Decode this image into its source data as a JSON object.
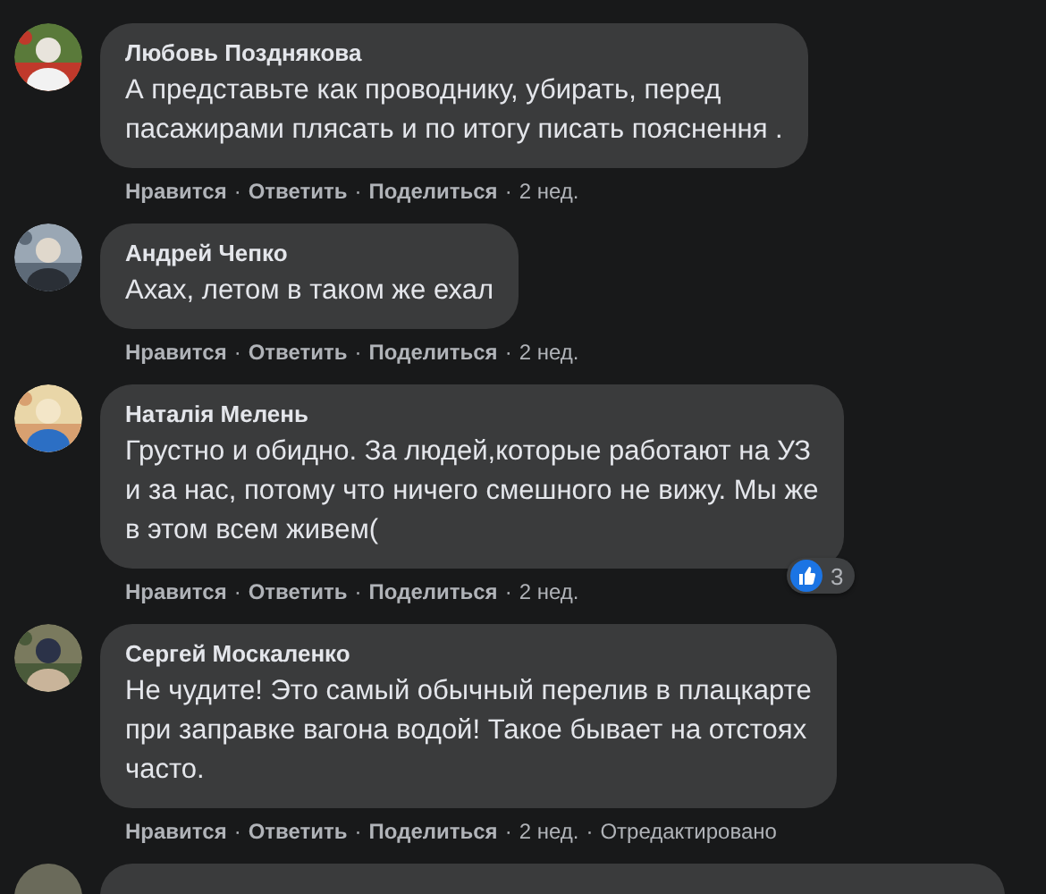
{
  "comments": [
    {
      "author": "Любовь Позднякова",
      "text": "А представьте как проводнику, убирать, перед\nпасажирами плясать и по итогу писать пояснення .",
      "actions": [
        {
          "kind": "link",
          "label": "Нравится"
        },
        {
          "kind": "link",
          "sep": "·",
          "label": "Ответить"
        },
        {
          "kind": "link",
          "sep": "·",
          "label": "Поделиться"
        },
        {
          "kind": "meta",
          "sep": "·",
          "label": "2 нед."
        }
      ]
    },
    {
      "author": "Андрей Чепко",
      "text": "Ахах, летом в таком же ехал",
      "actions": [
        {
          "kind": "link",
          "label": "Нравится"
        },
        {
          "kind": "link",
          "sep": "·",
          "label": "Ответить"
        },
        {
          "kind": "link",
          "sep": "·",
          "label": "Поделиться"
        },
        {
          "kind": "meta",
          "sep": "·",
          "label": "2 нед."
        }
      ]
    },
    {
      "author": "Наталія Мелень",
      "text": "Грустно и обидно. За людей,которые работают на УЗ\nи за нас, потому что ничего смешного не вижу. Мы же\nв этом всем живем(",
      "reactions": "3",
      "actions": [
        {
          "kind": "link",
          "label": "Нравится"
        },
        {
          "kind": "link",
          "sep": "·",
          "label": "Ответить"
        },
        {
          "kind": "link",
          "sep": "·",
          "label": "Поделиться"
        },
        {
          "kind": "meta",
          "sep": "·",
          "label": "2 нед."
        }
      ]
    },
    {
      "author": "Сергей Москаленко",
      "text": "Не чудите! Это самый обычный перелив в плацкарте\nпри заправке вагона водой! Такое бывает на отстоях\nчасто.",
      "actions": [
        {
          "kind": "link",
          "label": "Нравится"
        },
        {
          "kind": "link",
          "sep": "·",
          "label": "Ответить"
        },
        {
          "kind": "link",
          "sep": "·",
          "label": "Поделиться"
        },
        {
          "kind": "meta",
          "sep": "·",
          "label": "2 нед."
        },
        {
          "kind": "meta",
          "sep": "·",
          "label": "Отредактировано"
        }
      ]
    }
  ]
}
